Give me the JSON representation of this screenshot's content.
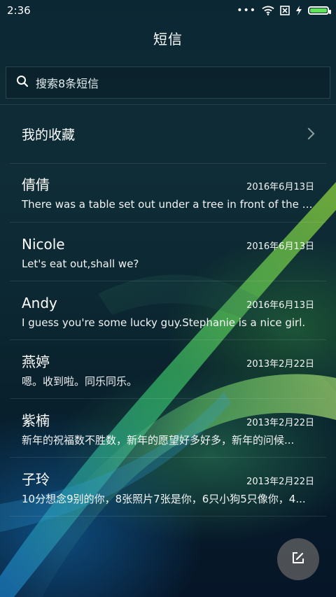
{
  "status_bar": {
    "time": "2:36",
    "dots": "•••",
    "icons": [
      "wifi-icon",
      "no-sim-icon",
      "charging-icon",
      "battery-icon"
    ],
    "battery_level": 1.0
  },
  "header": {
    "title": "短信"
  },
  "search": {
    "placeholder": "搜索8条短信"
  },
  "favorites": {
    "label": "我的收藏"
  },
  "conversations": [
    {
      "name": "倩倩",
      "date": "2016年6月13日",
      "snippet": "There was a table set out under a tree in front of the ho..."
    },
    {
      "name": "Nicole",
      "date": "2016年6月13日",
      "snippet": "Let's eat out,shall we?"
    },
    {
      "name": "Andy",
      "date": "2016年6月13日",
      "snippet": "I guess you're some lucky guy.Stephanie is a nice girl."
    },
    {
      "name": "燕婷",
      "date": "2013年2月22日",
      "snippet": "嗯。收到啦。同乐同乐。"
    },
    {
      "name": "紫楠",
      "date": "2013年2月22日",
      "snippet": "新年的祝福数不胜数，新年的愿望好多好多，新年的问候..."
    },
    {
      "name": "子玲",
      "date": "2013年2月22日",
      "snippet": "10分想念9别的你，8张照片7张是你，6只小狗5只像你，4..."
    }
  ],
  "fab": {
    "icon": "compose-icon"
  },
  "colors": {
    "battery_fill": "#5fe35a",
    "accent_green": "#52d94a"
  }
}
